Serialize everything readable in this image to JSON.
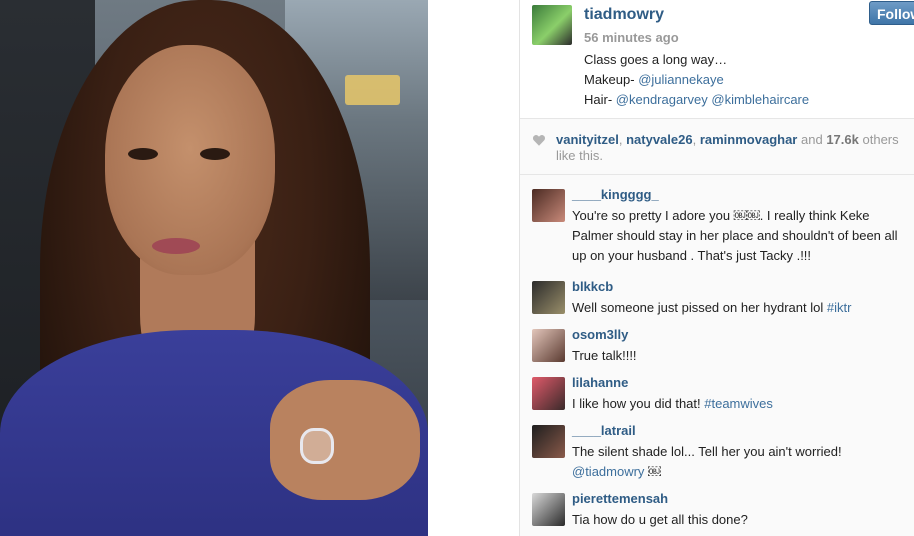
{
  "post": {
    "owner": "tiadmowry",
    "time": "56 minutes ago",
    "caption_line1": "Class goes a long way…",
    "caption_makeup_label": "Makeup- ",
    "caption_makeup_tag": "@juliannekaye",
    "caption_hair_label": "Hair- ",
    "caption_hair_tag1": "@kendragarvey",
    "caption_hair_tag2": "@kimblehaircare",
    "follow_label": "Follow"
  },
  "likes": {
    "users": [
      "vanityitzel",
      "natyvale26",
      "raminmovaghar"
    ],
    "and_label": "and",
    "count": "17.6k",
    "suffix": "others like this."
  },
  "comments": [
    {
      "user": "____kingggg_",
      "text": "You're so pretty I adore you ￼￼. I really think Keke Palmer should stay in her place and shouldn't of been all up on your husband . That's just Tacky .!!!"
    },
    {
      "user": "blkkcb",
      "text": "Well someone just pissed on her hydrant lol ",
      "tag": "#iktr"
    },
    {
      "user": "osom3lly",
      "text": "True talk!!!!"
    },
    {
      "user": "lilahanne",
      "text": "I like how you did that! ",
      "tag": "#teamwives"
    },
    {
      "user": "____latrail",
      "text": "The silent shade lol... Tell her you ain't worried! ",
      "tag": "@tiadmowry",
      "tail": " ￼"
    },
    {
      "user": "pierettemensah",
      "text": "Tia how do u get all this done?"
    }
  ],
  "colors": {
    "link": "#2f5c85",
    "follow_button": "#4f80b3",
    "shirt": "#343893"
  },
  "icons": {
    "like": "heart-icon"
  }
}
